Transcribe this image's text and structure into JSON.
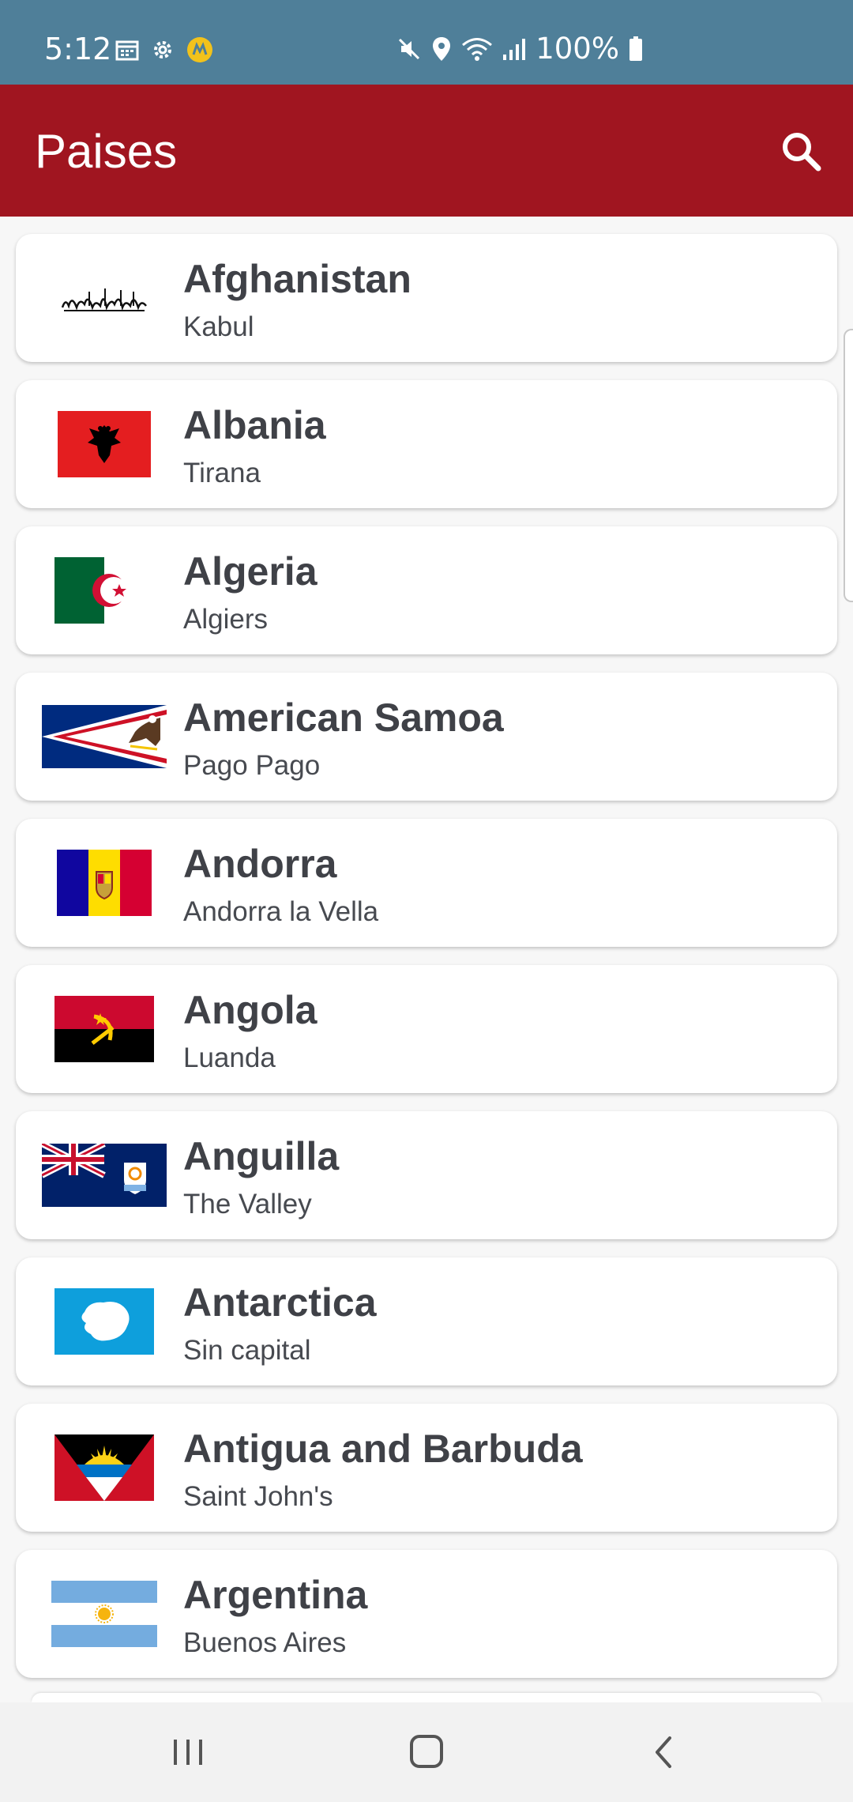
{
  "status_bar": {
    "time": "5:12",
    "battery": "100%",
    "icons": [
      "calendar-icon",
      "settings-icon",
      "app-notification-icon",
      "mute-icon",
      "location-icon",
      "wifi-icon",
      "signal-icon",
      "battery-icon"
    ]
  },
  "app_bar": {
    "title": "Paises",
    "search_icon": "search-icon",
    "background_color": "#a01520"
  },
  "countries": [
    {
      "name": "Afghanistan",
      "capital": "Kabul"
    },
    {
      "name": "Albania",
      "capital": "Tirana"
    },
    {
      "name": "Algeria",
      "capital": "Algiers"
    },
    {
      "name": "American Samoa",
      "capital": "Pago Pago"
    },
    {
      "name": "Andorra",
      "capital": "Andorra la Vella"
    },
    {
      "name": "Angola",
      "capital": "Luanda"
    },
    {
      "name": "Anguilla",
      "capital": "The Valley"
    },
    {
      "name": "Antarctica",
      "capital": "Sin capital"
    },
    {
      "name": "Antigua and Barbuda",
      "capital": "Saint John's"
    },
    {
      "name": "Argentina",
      "capital": "Buenos Aires"
    }
  ],
  "nav_bar": {
    "icons": [
      "recent-apps-icon",
      "home-icon",
      "back-icon"
    ]
  }
}
